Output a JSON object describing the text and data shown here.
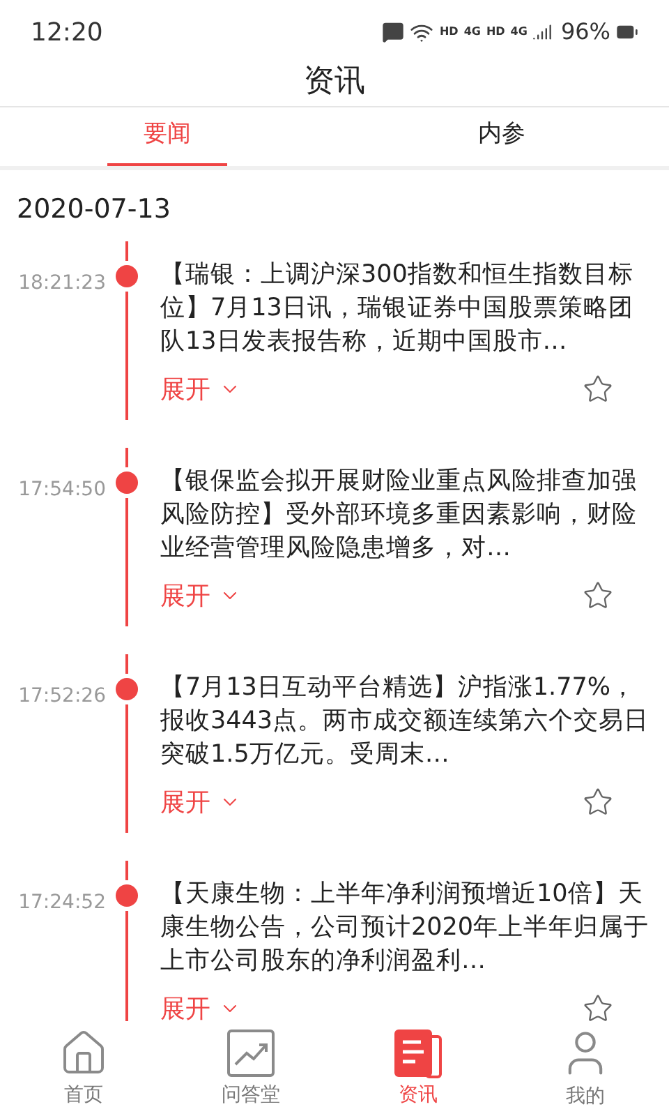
{
  "status_bar": {
    "time": "12:20",
    "network_labels": [
      "HD",
      "4G",
      "HD",
      "4G"
    ],
    "battery": "96%"
  },
  "title": "资讯",
  "tabs": [
    {
      "label": "要闻",
      "selected": true
    },
    {
      "label": "内参",
      "selected": false
    }
  ],
  "date": "2020-07-13",
  "news": [
    {
      "time": "18:21:23",
      "text": "【瑞银：上调沪深300指数和恒生指数目标位】7月13日讯，瑞银证券中国股票策略团队13日发表报告称，近期中国股市…",
      "expand": "展开",
      "starred": false
    },
    {
      "time": "17:54:50",
      "text": "【银保监会拟开展财险业重点风险排查加强风险防控】受外部环境多重因素影响，财险业经营管理风险隐患增多，对…",
      "expand": "展开",
      "starred": false
    },
    {
      "time": "17:52:26",
      "text": "【7月13日互动平台精选】沪指涨1.77%，报收3443点。两市成交额连续第六个交易日突破1.5万亿元。受周末…",
      "expand": "展开",
      "starred": false
    },
    {
      "time": "17:24:52",
      "text": "【天康生物：上半年净利润预增近10倍】天康生物公告，公司预计2020年上半年归属于上市公司股东的净利润盈利…",
      "expand": "展开",
      "starred": false
    }
  ],
  "bottom_nav": [
    {
      "kind": "home",
      "label": "首页",
      "selected": false
    },
    {
      "kind": "qa",
      "label": "问答堂",
      "selected": false
    },
    {
      "kind": "news",
      "label": "资讯",
      "selected": true
    },
    {
      "kind": "me",
      "label": "我的",
      "selected": false
    }
  ]
}
